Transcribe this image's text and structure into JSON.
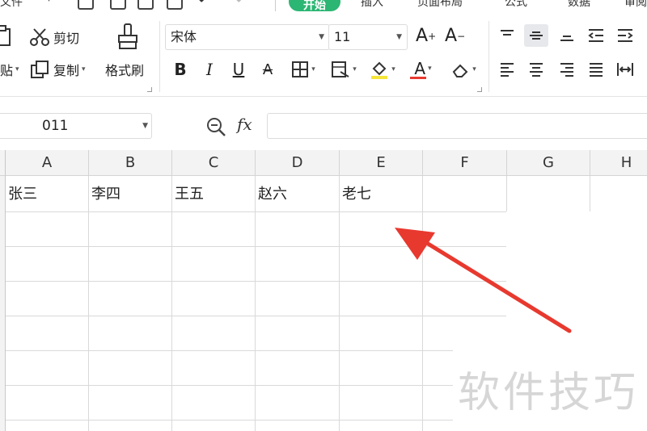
{
  "tabs": {
    "file": "文件",
    "start": "开始",
    "insert": "插入",
    "page_layout": "页面布局",
    "formula": "公式",
    "data": "数据",
    "review": "审阅"
  },
  "ribbon": {
    "cut": "剪切",
    "paste": "贴",
    "copy": "复制",
    "format_painter": "格式刷",
    "font_name": "宋体",
    "font_size": "11",
    "bold": "B",
    "italic": "I",
    "underline": "U",
    "strike": "A",
    "font_color_letter": "A",
    "grow": "A",
    "shrink": "A"
  },
  "formula_bar": {
    "name_box": "011",
    "fx": "fx",
    "value": ""
  },
  "columns": [
    "A",
    "B",
    "C",
    "D",
    "E",
    "F",
    "G",
    "H"
  ],
  "row1": [
    "张三",
    "李四",
    "王五",
    "赵六",
    "老七",
    "",
    "",
    ""
  ],
  "watermark": "软件技巧",
  "colors": {
    "accent": "#2bb673",
    "arrow": "#e8392f",
    "font_color_bar": "#e8392f",
    "fill_color_bar": "#f5e53b"
  }
}
